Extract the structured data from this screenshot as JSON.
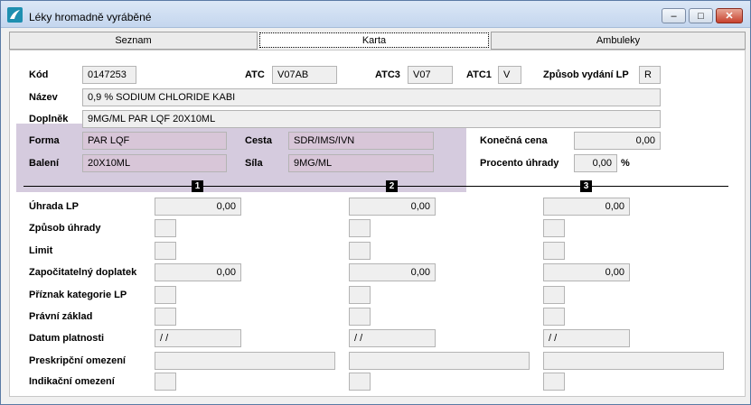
{
  "window": {
    "title": "Léky hromadně vyráběné",
    "minimize_glyph": "–",
    "maximize_glyph": "□",
    "close_glyph": "✕"
  },
  "tabs": [
    {
      "label": "Seznam"
    },
    {
      "label": "Karta"
    },
    {
      "label": "Ambuleky"
    }
  ],
  "card": {
    "kod_label": "Kód",
    "kod_value": "0147253",
    "atc_label": "ATC",
    "atc_value": "V07AB",
    "atc3_label": "ATC3",
    "atc3_value": "V07",
    "atc1_label": "ATC1",
    "atc1_value": "V",
    "zpusob_label": "Způsob vydání LP",
    "zpusob_value": "R",
    "nazev_label": "Název",
    "nazev_value": "0,9 % SODIUM CHLORIDE KABI",
    "doplnek_label": "Doplněk",
    "doplnek_value": "9MG/ML PAR LQF 20X10ML",
    "forma_label": "Forma",
    "forma_value": "PAR LQF",
    "cesta_label": "Cesta",
    "cesta_value": "SDR/IMS/IVN",
    "baleni_label": "Balení",
    "baleni_value": "20X10ML",
    "sila_label": "Síla",
    "sila_value": "9MG/ML",
    "konecna_label": "Konečná cena",
    "konecna_value": "0,00",
    "procento_label": "Procento úhrady",
    "procento_value": "0,00",
    "procento_unit": "%"
  },
  "columns": [
    "1",
    "2",
    "3"
  ],
  "rows": {
    "uhrada": "Úhrada LP",
    "zpusob_uhrady": "Způsob úhrady",
    "limit": "Limit",
    "doplatek": "Započitatelný doplatek",
    "priznak": "Příznak kategorie LP",
    "pravni": "Právní základ",
    "datum": "Datum platnosti",
    "preskripcni": "Preskripční omezení",
    "indikacni": "Indikační omezení"
  },
  "values": {
    "uhrada": [
      "0,00",
      "0,00",
      "0,00"
    ],
    "doplatek": [
      "0,00",
      "0,00",
      "0,00"
    ],
    "datum": [
      "/ /",
      "/ /",
      "/ /"
    ]
  },
  "colors": {
    "highlight": "#b9a9c8",
    "titlebar": "#c4d6ee"
  },
  "icons": {
    "app": "app-logo-icon"
  }
}
